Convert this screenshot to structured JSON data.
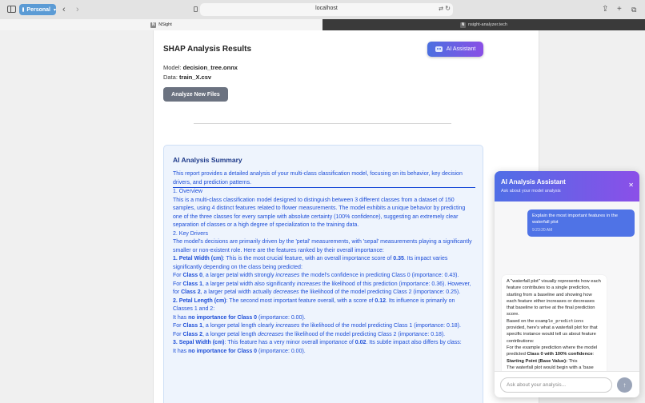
{
  "browser": {
    "profile_label": "Personal",
    "url": "localhost",
    "tabs": [
      {
        "favicon": "N",
        "label": "NSight"
      },
      {
        "favicon": "N",
        "label": "nsight-analyzer.tech"
      }
    ]
  },
  "results": {
    "title": "SHAP Analysis Results",
    "ai_button_label": "AI Assistant",
    "model_label": "Model:",
    "model_value": "decision_tree.onnx",
    "data_label": "Data:",
    "data_value": "train_X.csv",
    "analyze_button_label": "Analyze New Files"
  },
  "summary": {
    "title": "AI Analysis Summary",
    "intro": "This report provides a detailed analysis of your multi-class classification model, focusing on its behavior, key decision drivers, and prediction patterns.",
    "s1_heading": "1. Overview",
    "s1_text": "This is a multi-class classification model designed to distinguish between 3 different classes from a dataset of 150 samples, using 4 distinct features related to flower measurements. The model exhibits a unique behavior by predicting one of the three classes for every sample with absolute certainty (100% confidence), suggesting an extremely clear separation of classes or a high degree of specialization to the training data.",
    "s2_heading": "2. Key Drivers",
    "s2_text": "The model's decisions are primarily driven by the 'petal' measurements, with 'sepal' measurements playing a significantly smaller or non-existent role. Here are the features ranked by their overall importance:",
    "f1_name": "1. Petal Width (cm)",
    "f1_pre": ": This is the most crucial feature, with an overall importance score of ",
    "f1_score": "0.35",
    "f1_post": ". Its impact varies significantly depending on the class being predicted:",
    "f1_c0_a": "For ",
    "f1_c0_class": "Class 0",
    "f1_c0_b": ", a larger petal width strongly ",
    "f1_c0_verb": "increases",
    "f1_c0_c": " the model's confidence in predicting Class 0 (importance: 0.43).",
    "f1_c1_a": "For ",
    "f1_c1_class": "Class 1",
    "f1_c1_b": ", a larger petal width also significantly ",
    "f1_c1_verb": "increases",
    "f1_c1_c": " the likelihood of this prediction (importance: 0.36). However, for ",
    "f1_c2_class": "Class 2",
    "f1_c2_b": ", a larger petal width actually ",
    "f1_c2_verb": "decreases",
    "f1_c2_c": " the likelihood of the model predicting Class 2 (importance: 0.25).",
    "f2_name": "2. Petal Length (cm)",
    "f2_pre": ": The second most important feature overall, with a score of ",
    "f2_score": "0.12",
    "f2_post": ". Its influence is primarily on Classes 1 and 2:",
    "f2_c0_a": "It has ",
    "f2_c0_bold": "no importance for Class 0",
    "f2_c0_b": " (importance: 0.00).",
    "f2_c1_a": "For ",
    "f2_c1_class": "Class 1",
    "f2_c1_b": ", a longer petal length clearly ",
    "f2_c1_verb": "increases",
    "f2_c1_c": " the likelihood of the model predicting Class 1 (importance: 0.18).",
    "f2_c2_a": "For ",
    "f2_c2_class": "Class 2",
    "f2_c2_b": ", a longer petal length ",
    "f2_c2_verb": "decreases",
    "f2_c2_c": " the likelihood of the model predicting Class 2 (importance: 0.18).",
    "f3_name": "3. Sepal Width (cm)",
    "f3_pre": ": This feature has a very minor overall importance of ",
    "f3_score": "0.02",
    "f3_post": ". Its subtle impact also differs by class:",
    "f3_c0_a": "It has ",
    "f3_c0_bold": "no importance for Class 0",
    "f3_c0_b": " (importance: 0.00)."
  },
  "assistant": {
    "title": "AI Analysis Assistant",
    "subtitle": "Ask about your model analysis",
    "user_message": "Explain the most important features in the waterfall plot",
    "user_time": "9:23:20 AM",
    "bot_p1": "A \"waterfall plot\" visually represents how each feature contributes to a single prediction, starting from a baseline and showing how each feature either increases or decreases that baseline to arrive at the final prediction score.",
    "bot_p2_a": "Based on the ",
    "bot_p2_code": "example_predictions",
    "bot_p2_b": " provided, here's what a waterfall plot for that specific instance would tell us about feature contributions:",
    "bot_p3_a": "For the example prediction where the model predicted ",
    "bot_p3_bold": "Class 0 with 100% confidence",
    "bot_p3_b": ":",
    "bot_p4_bold": "Starting Point (Base Value):",
    "bot_p4_text": " This",
    "bot_p5": "The waterfall plot would begin with a 'base",
    "input_placeholder": "Ask about your analysis...",
    "send_icon": "↑"
  }
}
